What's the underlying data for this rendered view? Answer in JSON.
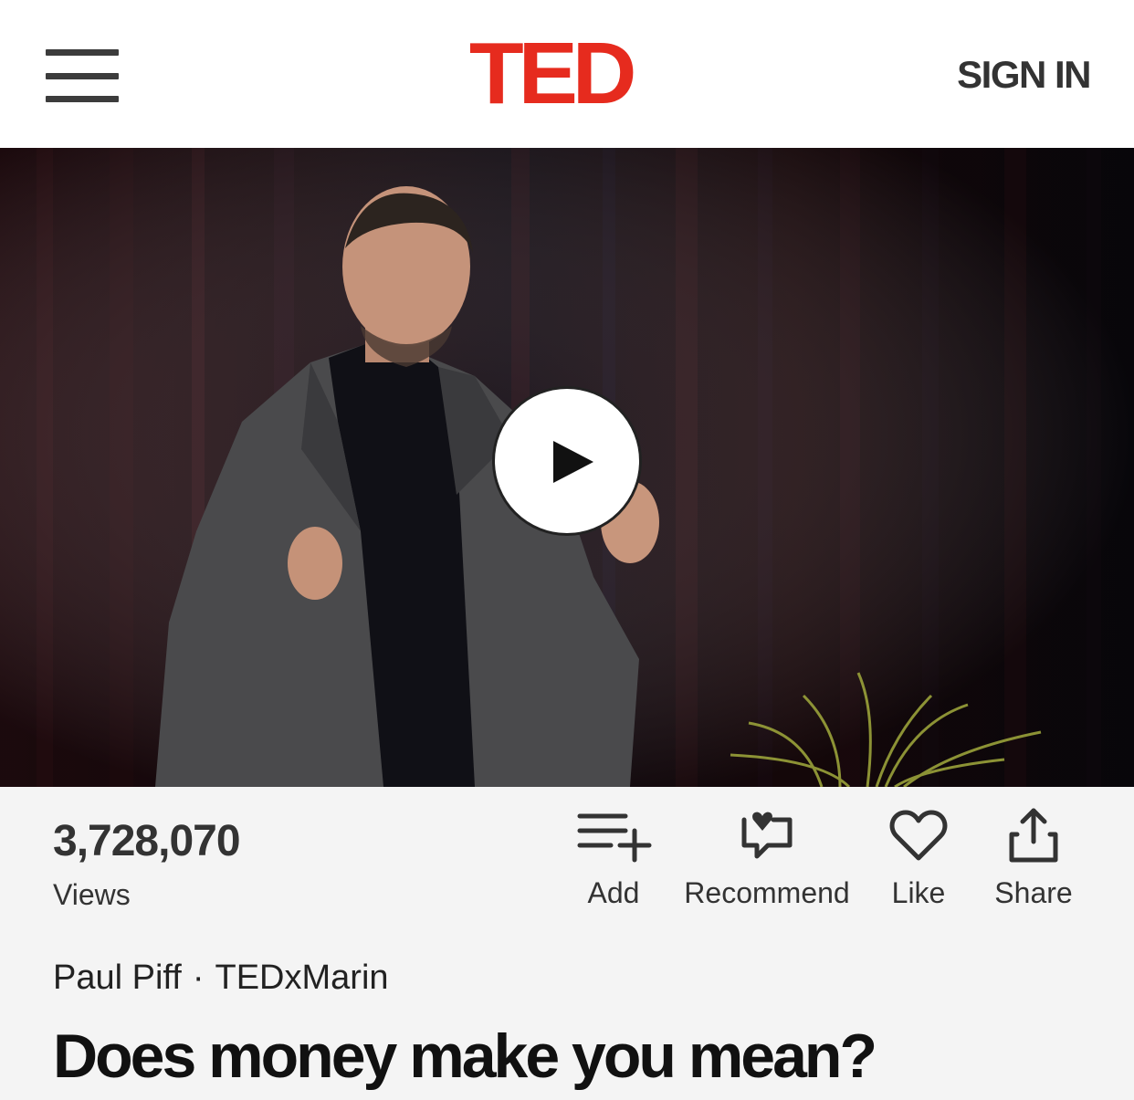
{
  "header": {
    "logo_text": "TED",
    "sign_in_label": "SIGN IN",
    "logo_color": "#e62b1e"
  },
  "video": {
    "play_icon": "play-icon"
  },
  "stats": {
    "views_count": "3,728,070",
    "views_label": "Views"
  },
  "actions": [
    {
      "label": "Add",
      "icon": "add-to-list-icon"
    },
    {
      "label": "Recommend",
      "icon": "recommend-icon"
    },
    {
      "label": "Like",
      "icon": "heart-icon"
    },
    {
      "label": "Share",
      "icon": "share-icon"
    }
  ],
  "talk": {
    "speaker": "Paul Piff",
    "separator": "·",
    "event": "TEDxMarin",
    "title": "Does money make you mean?"
  }
}
